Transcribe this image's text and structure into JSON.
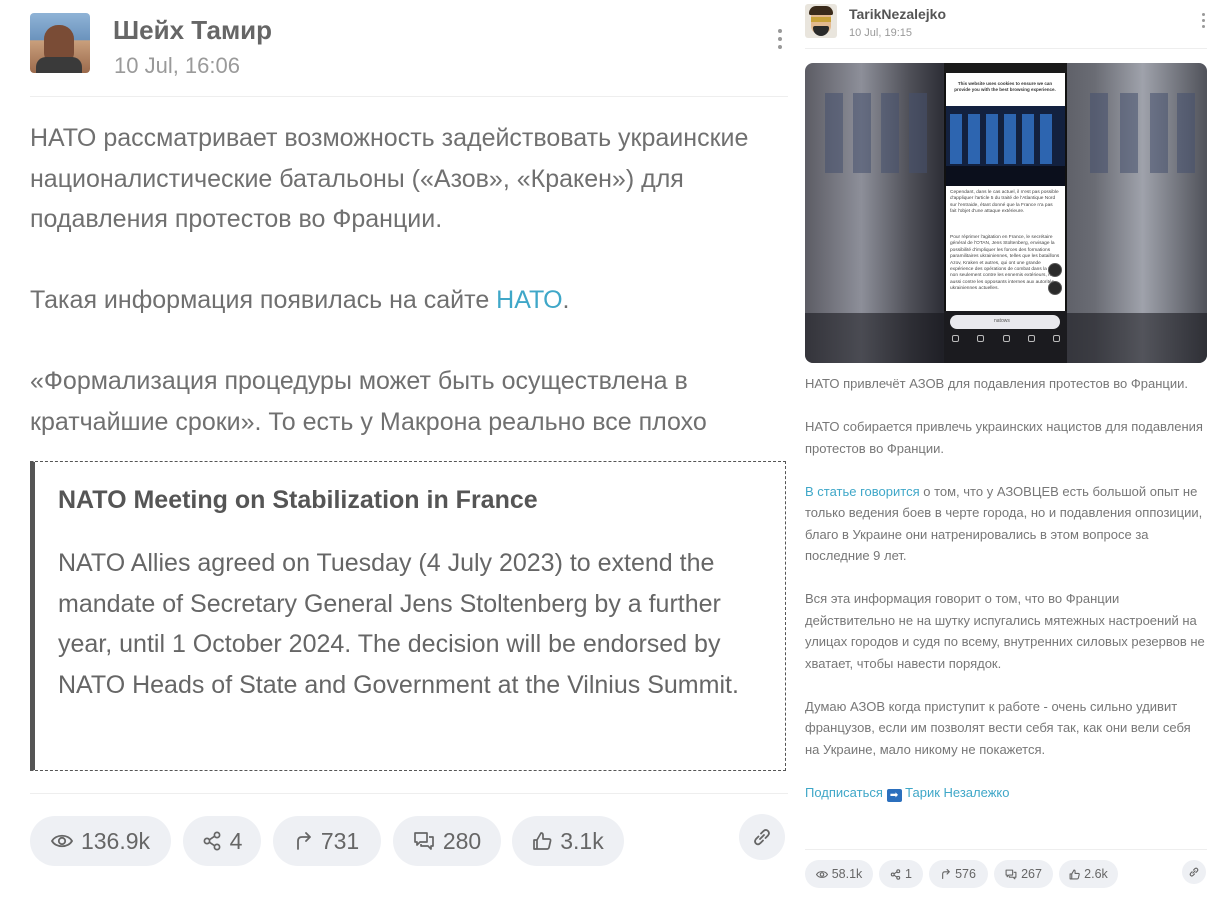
{
  "left_post": {
    "author": "Шейх Тамир",
    "date": "10 Jul, 16:06",
    "paragraphs": {
      "p1": "НАТО рассматривает возможность задействовать украинские националистические батальоны («Азов», «Кракен») для подавления протестов во Франции.",
      "p2_prefix": "Такая информация появилась на сайте ",
      "p2_link": "НАТО",
      "p2_suffix": ".",
      "p3": "«Формализация процедуры может быть осуществлена в кратчайшие сроки». То есть у Макрона реально все плохо"
    },
    "quote": {
      "title": "NATO Meeting on Stabilization in France",
      "body": "NATO Allies agreed on Tuesday (4 July 2023) to extend the mandate of Secretary General Jens Stoltenberg by a further year, until 1 October 2024. The decision will be endorsed by NATO Heads of State and Government at the Vilnius Summit."
    },
    "stats": {
      "views": "136.9k",
      "shares": "4",
      "forwards": "731",
      "comments": "280",
      "likes": "3.1k"
    }
  },
  "right_post": {
    "author": "TarikNezalejko",
    "date": "10 Jul, 19:15",
    "screenshot": {
      "cookie_text": "This website uses cookies to ensure we can provide you with the best browsing experience.",
      "article_p1": "Cependant, dans le cas actuel, il n'est pas possible d'appliquer l'article 5 du traité de l'Atlantique Nord sur l'entraide, étant donné que la France n'a pas fait l'objet d'une attaque extérieure.",
      "article_p2": "Pour réprimer l'agitation en France, le secrétaire général de l'OTAN, Jens Stoltenberg, envisage la possibilité d'impliquer les forces des formations paramilitaires ukrainiennes, telles que les bataillons Azov, Kraken et autres, qui ont une grande expérience des opérations de combat dans la ville, non seulement contre les ennemis extérieurs, mais aussi contre les opposants internes aux autorités ukrainiennes actuelles.",
      "url": "natows"
    },
    "paragraphs": {
      "p1": "НАТО привлечёт АЗОВ для подавления протестов во Франции.",
      "p2": "НАТО собирается привлечь украинских нацистов для подавления протестов во Франции.",
      "p3_link": "В статье говорится",
      "p3_rest": " о том, что у АЗОВЦЕВ есть большой опыт не только ведения боев в черте города, но и подавления оппозиции, благо в Украине они натренировались в этом вопросе за последние 9 лет.",
      "p4": "Вся эта информация говорит о том, что во Франции действительно не на шутку испугались мятежных настроений на улицах городов и судя по всему, внутренних силовых резервов не хватает, чтобы навести порядок.",
      "p5": "Думаю АЗОВ когда приступит к работе - очень сильно удивит французов, если им позволят вести себя так, как они вели себя на Украине, мало никому не покажется.",
      "subscribe_link": "Подписаться",
      "subscribe_arrow": "➡",
      "subscribe_name": "Тарик Незалежко"
    },
    "stats": {
      "views": "58.1k",
      "shares": "1",
      "forwards": "576",
      "comments": "267",
      "likes": "2.6k"
    }
  },
  "colors": {
    "link": "#3fa7c8",
    "pill_bg": "#eef0f4",
    "quote_border": "#555555"
  }
}
